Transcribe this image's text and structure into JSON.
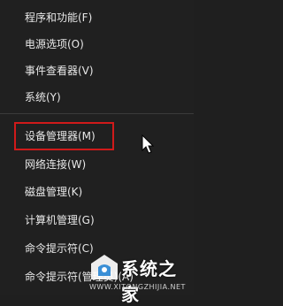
{
  "menu": {
    "items": [
      {
        "label": "程序和功能(F)"
      },
      {
        "label": "电源选项(O)"
      },
      {
        "label": "事件查看器(V)"
      },
      {
        "label": "系统(Y)"
      },
      {
        "label": "设备管理器(M)"
      },
      {
        "label": "网络连接(W)"
      },
      {
        "label": "磁盘管理(K)"
      },
      {
        "label": "计算机管理(G)"
      },
      {
        "label": "命令提示符(C)"
      },
      {
        "label": "命令提示符(管理员)(A)"
      }
    ],
    "highlighted_item": "设备管理器(M)"
  },
  "watermark": {
    "brand": "系统之家",
    "url": "WWW.XITONGZHIJIA.NET"
  },
  "colors": {
    "menu_bg": "#202020",
    "text": "#e8e8e8",
    "highlight_border": "#d01a1a"
  }
}
